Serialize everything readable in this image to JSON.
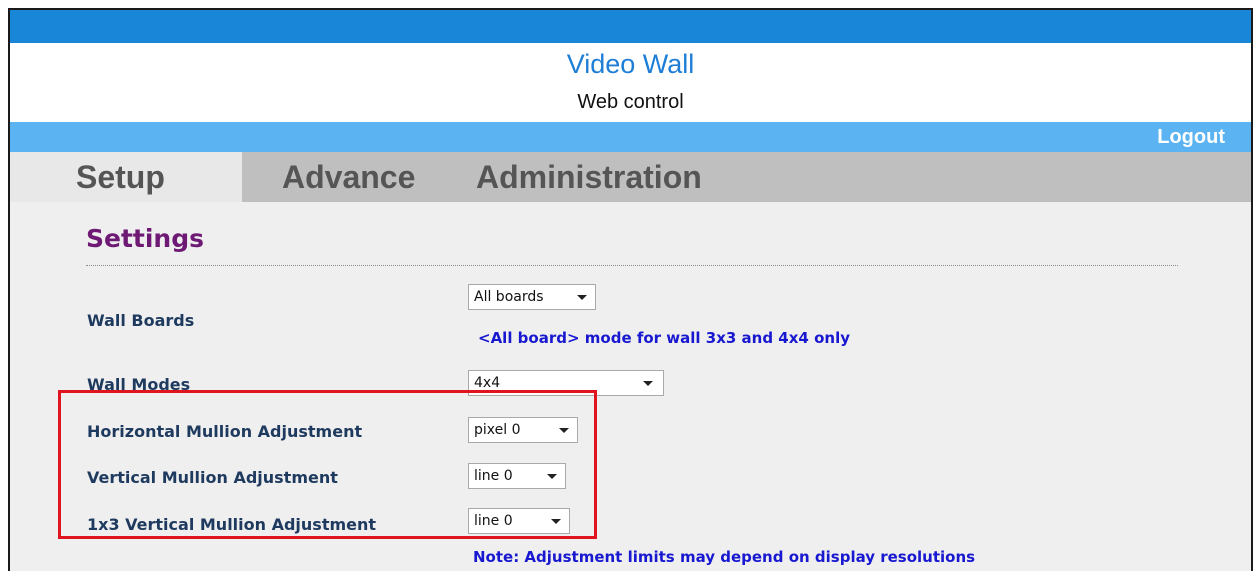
{
  "header": {
    "title": "Video Wall",
    "subtitle": "Web control",
    "logout_label": "Logout"
  },
  "tabs": [
    {
      "label": "Setup",
      "active": true
    },
    {
      "label": "Advance",
      "active": false
    },
    {
      "label": "Administration",
      "active": false
    }
  ],
  "settings": {
    "title": "Settings",
    "rows": [
      {
        "label": "Wall Boards",
        "value": "All boards"
      },
      {
        "label": "Wall Modes",
        "value": "4x4"
      },
      {
        "label": "Horizontal Mullion Adjustment",
        "value": "pixel 0"
      },
      {
        "label": "Vertical Mullion Adjustment",
        "value": "line 0"
      },
      {
        "label": "1x3 Vertical Mullion Adjustment",
        "value": "line 0"
      }
    ],
    "wall_boards_note": "<All board> mode for wall 3x3 and 4x4 only",
    "adjustment_note": "Note: Adjustment limits may depend on display resolutions"
  },
  "colors": {
    "top_bar": "#1a86d8",
    "nav_bar": "#5cb3f1",
    "settings_title": "#6e1a74",
    "highlight_border": "#e0141e"
  }
}
